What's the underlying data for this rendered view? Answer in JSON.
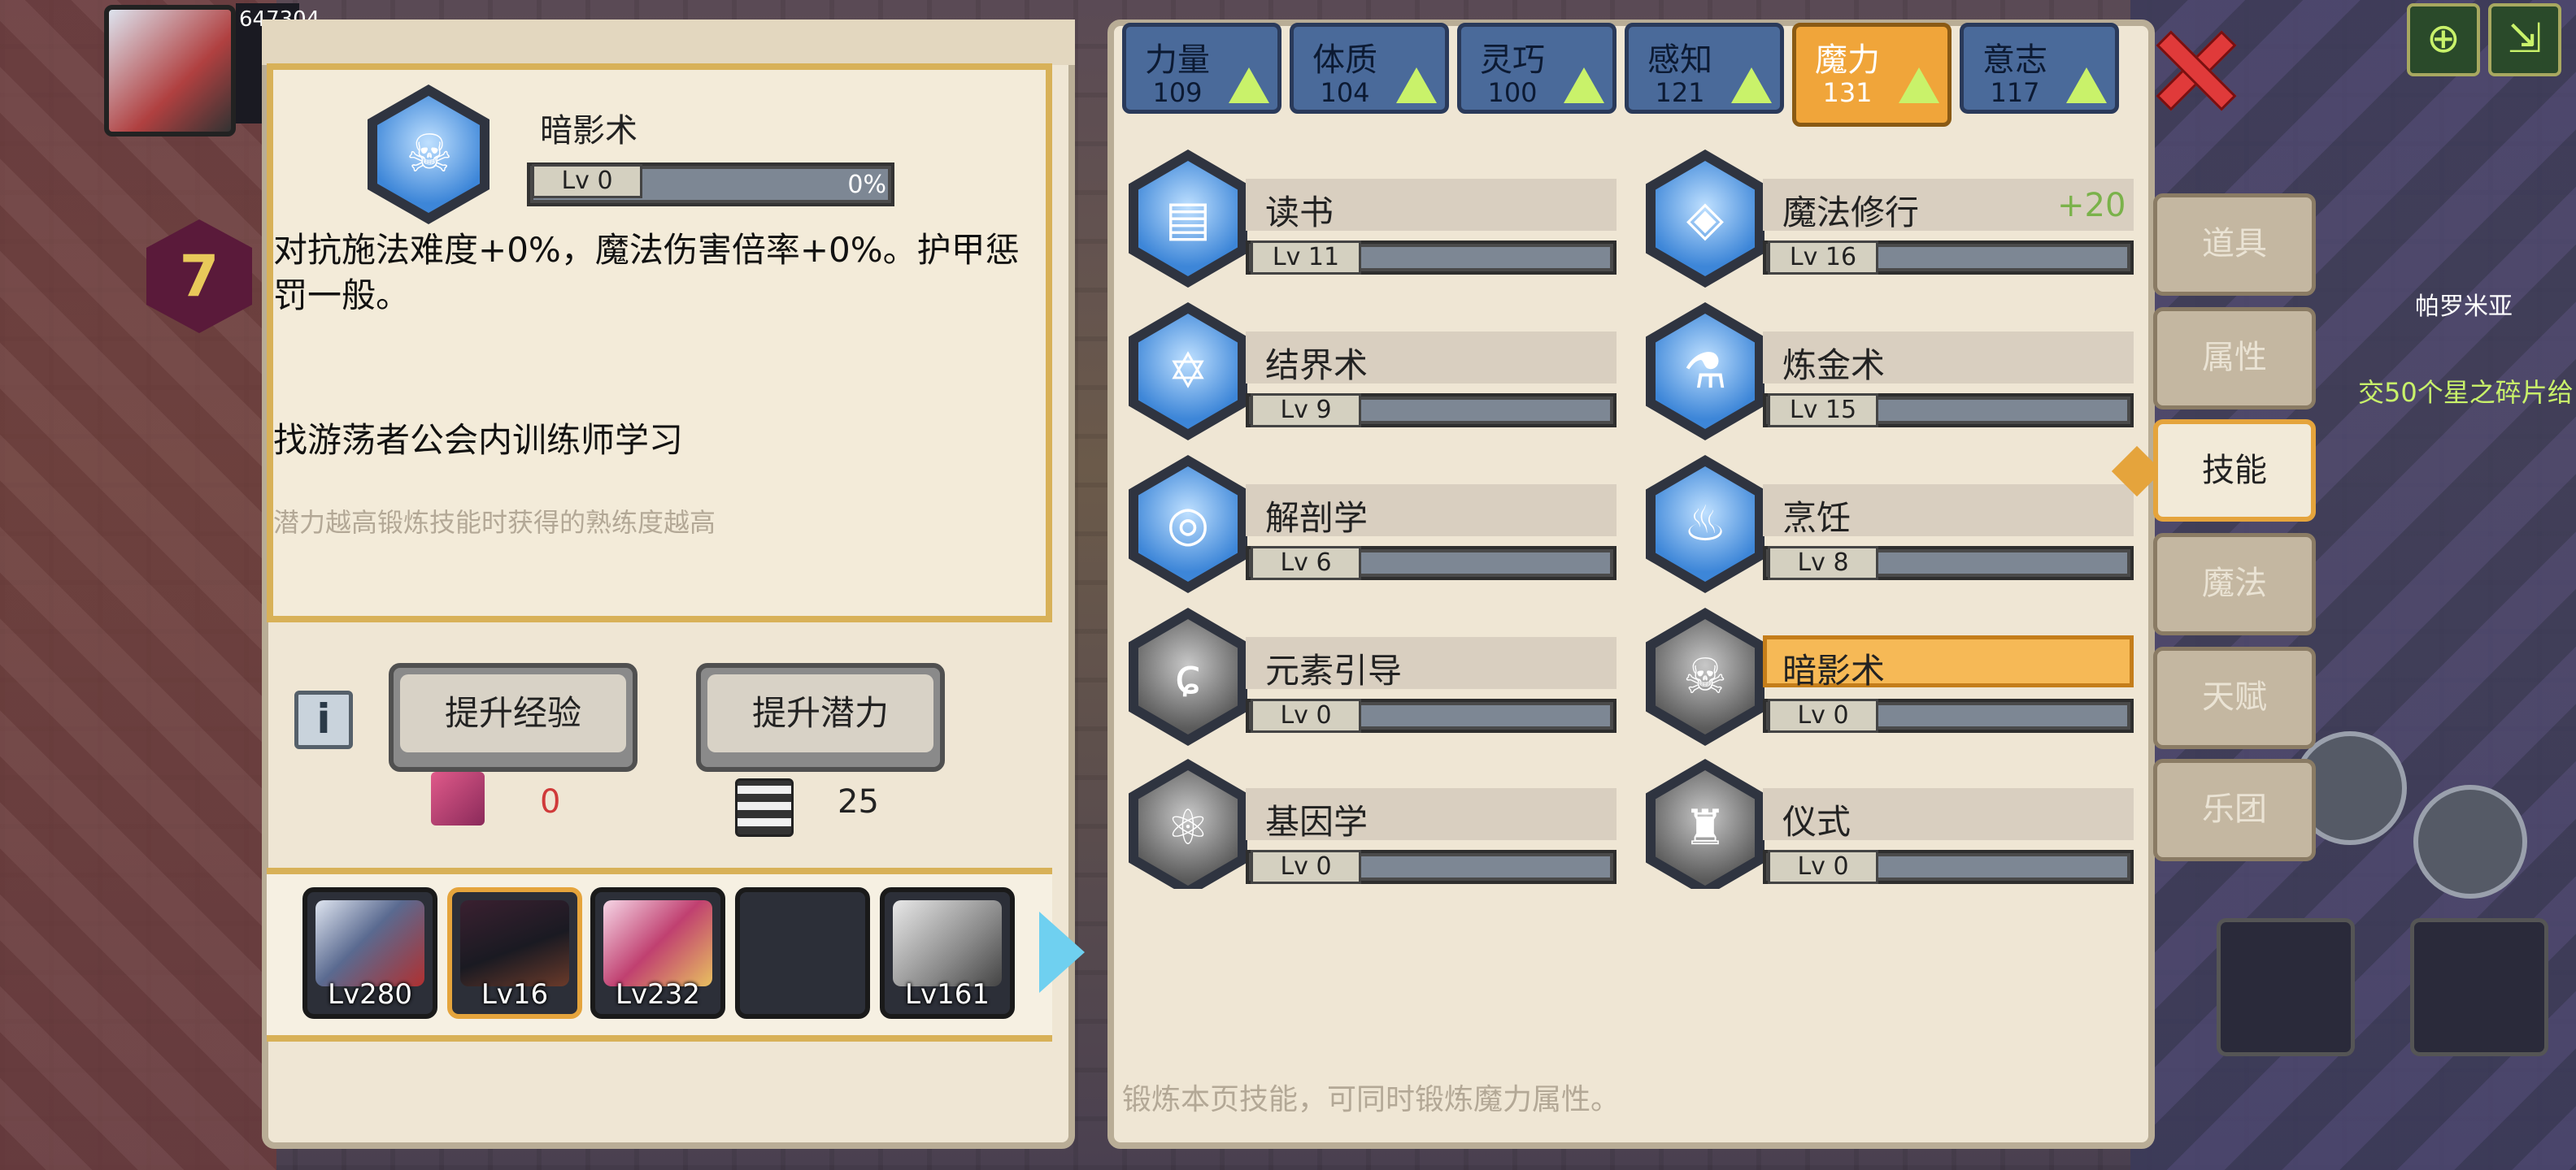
{
  "hud": {
    "hp_value": "647304",
    "level_badge": "7",
    "map_name": "帕罗米亚",
    "quest_text": "交50个星之碎片给"
  },
  "detail": {
    "skill_name": "暗影术",
    "level_label": "Lv 0",
    "progress_percent": "0%",
    "description": "对抗施法难度+0%，魔法伤害倍率+0%。护甲惩罚一般。",
    "learn_hint": "找游荡者公会内训练师学习",
    "potential_hint": "潜力越高锻炼技能时获得的熟练度越高",
    "info_icon": "i",
    "exp_button": "提升经验",
    "potential_button": "提升潜力",
    "exp_resource": "0",
    "potential_resource": "25"
  },
  "party": [
    {
      "level": "Lv280"
    },
    {
      "level": "Lv16"
    },
    {
      "level": "Lv232"
    },
    {
      "level": ""
    },
    {
      "level": "Lv161"
    }
  ],
  "attribute_tabs": [
    {
      "label": "力量",
      "value": "109"
    },
    {
      "label": "体质",
      "value": "104"
    },
    {
      "label": "灵巧",
      "value": "100"
    },
    {
      "label": "感知",
      "value": "121"
    },
    {
      "label": "魔力",
      "value": "131"
    },
    {
      "label": "意志",
      "value": "117"
    }
  ],
  "skills": [
    {
      "name": "读书",
      "level": "Lv 11",
      "icon": "book-icon",
      "bonus": ""
    },
    {
      "name": "魔法修行",
      "level": "Lv 16",
      "icon": "magic-gem-icon",
      "bonus": "+20"
    },
    {
      "name": "结界术",
      "level": "Lv 9",
      "icon": "star-of-david-icon",
      "bonus": ""
    },
    {
      "name": "炼金术",
      "level": "Lv 15",
      "icon": "flask-icon",
      "bonus": ""
    },
    {
      "name": "解剖学",
      "level": "Lv 6",
      "icon": "meat-icon",
      "bonus": ""
    },
    {
      "name": "烹饪",
      "level": "Lv 8",
      "icon": "cooking-pot-icon",
      "bonus": ""
    },
    {
      "name": "元素引导",
      "level": "Lv 0",
      "icon": "element-swirl-icon",
      "bonus": ""
    },
    {
      "name": "暗影术",
      "level": "Lv 0",
      "icon": "skull-flame-icon",
      "bonus": ""
    },
    {
      "name": "基因学",
      "level": "Lv 0",
      "icon": "molecule-icon",
      "bonus": ""
    },
    {
      "name": "仪式",
      "level": "Lv 0",
      "icon": "candle-icon",
      "bonus": ""
    }
  ],
  "footer": "锻炼本页技能，可同时锻炼魔力属性。",
  "side_menu": [
    "道具",
    "属性",
    "技能",
    "魔法",
    "天赋",
    "乐团"
  ],
  "colors": {
    "accent": "#f0a53a",
    "bonus": "#7ab24a",
    "tab_blue": "#4a6a9a",
    "close": "#e03a3a"
  }
}
